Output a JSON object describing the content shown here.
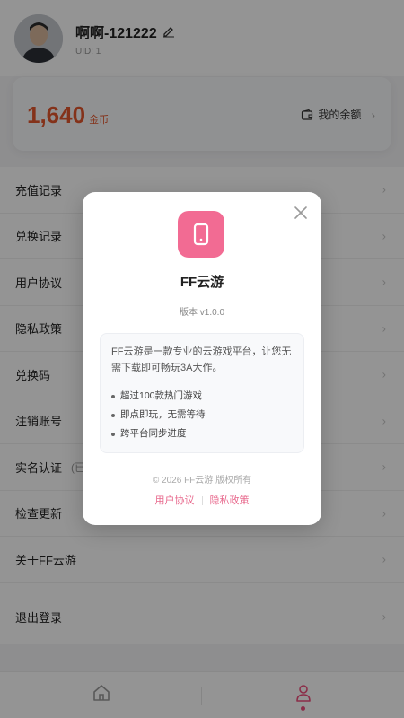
{
  "profile": {
    "username": "啊啊-121222",
    "uid": "UID: 1"
  },
  "balance": {
    "coins_value": "1,640",
    "coins_unit": "金币",
    "link_label": "我的余额"
  },
  "menu": {
    "items": [
      {
        "label": "充值记录"
      },
      {
        "label": "兑换记录"
      },
      {
        "label": "用户协议"
      },
      {
        "label": "隐私政策"
      },
      {
        "label": "兑换码"
      },
      {
        "label": "注销账号"
      },
      {
        "label": "实名认证",
        "extra": "(已"
      },
      {
        "label": "检查更新"
      },
      {
        "label": "关于FF云游"
      },
      {
        "label": "退出登录"
      }
    ]
  },
  "tabbar": {
    "tabs": [
      {
        "icon": "home-icon",
        "active": false
      },
      {
        "icon": "user-icon",
        "active": true
      }
    ]
  },
  "modal": {
    "app_name": "FF云游",
    "version": "版本 v1.0.0",
    "description": "FF云游是一款专业的云游戏平台，让您无需下载即可畅玩3A大作。",
    "features": [
      "超过100款热门游戏",
      "即点即玩，无需等待",
      "跨平台同步进度"
    ],
    "copyright": "© 2026 FF云游 版权所有",
    "links": {
      "agreement": "用户协议",
      "privacy": "隐私政策"
    }
  },
  "colors": {
    "accent_pink": "#f26b93",
    "coins_orange": "#e4572e"
  }
}
